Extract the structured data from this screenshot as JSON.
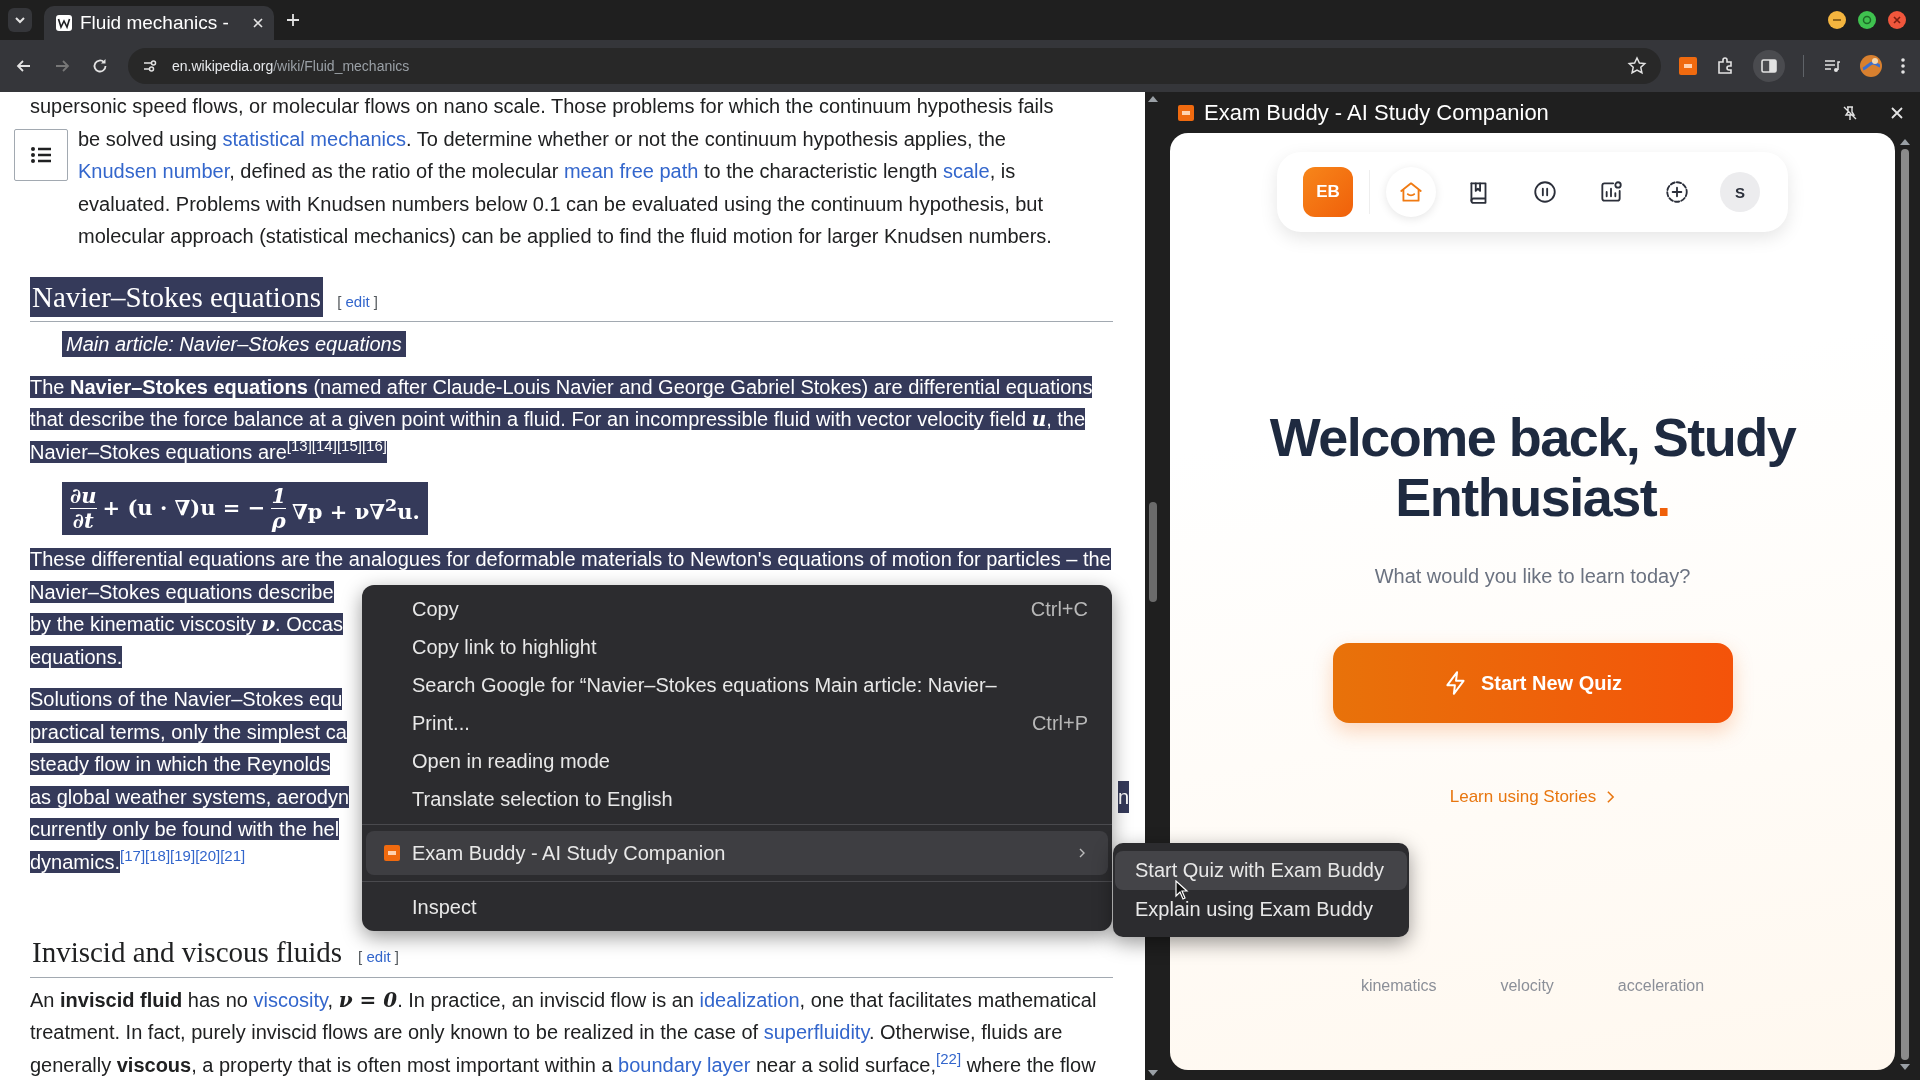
{
  "browser": {
    "tabs": [
      {
        "title": "Fluid mechanics -",
        "selected": true
      }
    ],
    "back_disabled": false,
    "forward_disabled": true,
    "url_host": "en.wikipedia.org",
    "url_path": "/wiki/Fluid_mechanics",
    "side_panel_open": true
  },
  "article": {
    "blocks": [
      {
        "kind": "paragraph",
        "highlighted": false,
        "parts": [
          {
            "kind": "text",
            "text": "supersonic speed flows, or molecular flows on nano scale. Those problems for which the continuum hypothesis fails"
          }
        ]
      },
      {
        "kind": "paragraph",
        "highlighted": false,
        "toc": true,
        "parts": [
          {
            "kind": "text",
            "text": "be solved using "
          },
          {
            "kind": "link",
            "text": "statistical mechanics"
          },
          {
            "kind": "text",
            "text": ". To determine whether or not the continuum hypothesis applies, the "
          },
          {
            "kind": "link",
            "text": "Knudsen number"
          },
          {
            "kind": "text",
            "text": ", defined as the ratio of the molecular "
          },
          {
            "kind": "link",
            "text": "mean free path"
          },
          {
            "kind": "text",
            "text": " to the characteristic length "
          },
          {
            "kind": "link",
            "text": "scale"
          },
          {
            "kind": "text",
            "text": ", is evaluated. Problems with Knudsen numbers below 0.1 can be evaluated using the continuum hypothesis, but molecular approach (statistical mechanics) can be applied to find the fluid motion for larger Knudsen numbers."
          }
        ]
      },
      {
        "kind": "heading",
        "highlighted": true,
        "text": "Navier–Stokes equations",
        "edit": "edit",
        "brackets": [
          "[",
          "]"
        ]
      },
      {
        "kind": "hatnote",
        "highlighted": true,
        "parts": [
          {
            "kind": "text",
            "text": "Main article: Navier–Stokes equations"
          }
        ]
      },
      {
        "kind": "paragraph",
        "highlighted": true,
        "parts": [
          {
            "kind": "text",
            "text": "The **Navier–Stokes equations** (named after Claude-Louis Navier and George Gabriel Stokes) are differential equations that describe the force balance at a given point within a fluid. For an incompressible fluid with vector velocity field "
          },
          {
            "kind": "math",
            "text": "u"
          },
          {
            "kind": "text",
            "text": ", the Navier–Stokes equations are"
          },
          {
            "kind": "ref",
            "text": "[13]"
          },
          {
            "kind": "ref",
            "text": "[14]"
          },
          {
            "kind": "ref",
            "text": "[15]"
          },
          {
            "kind": "ref",
            "text": "[16]"
          }
        ]
      },
      {
        "kind": "formula",
        "highlighted": true,
        "num1": "∂u",
        "den1": "∂t",
        "middle": "+ (u · ∇)u = −",
        "num2": "1",
        "den2": "ρ",
        "tail": "∇p + ν∇$^{2}$u."
      },
      {
        "kind": "lines",
        "highlighted": true,
        "lines": [
          {
            "parts": [
              {
                "kind": "text",
                "text": "These differential equations are the analogues for deformable materials to Newton's equations of motion for particles – the"
              }
            ]
          },
          {
            "parts": [
              {
                "kind": "text",
                "text": "Navier–Stokes equations describe"
              }
            ]
          },
          {
            "parts": [
              {
                "kind": "text",
                "text": "by the kinematic viscosity "
              },
              {
                "kind": "math",
                "text": "ν"
              },
              {
                "kind": "text",
                "text": ". Occas"
              }
            ]
          },
          {
            "parts": [
              {
                "kind": "text",
                "text": "equations."
              }
            ]
          }
        ]
      },
      {
        "kind": "lines",
        "highlighted": true,
        "lines": [
          {
            "parts": [
              {
                "kind": "text",
                "text": "Solutions of the Navier–Stokes equ"
              }
            ]
          },
          {
            "parts": [
              {
                "kind": "text",
                "text": "practical terms, only the simplest ca"
              }
            ]
          },
          {
            "parts": [
              {
                "kind": "text",
                "text": "steady flow in which the Reynolds"
              }
            ]
          },
          {
            "parts": [
              {
                "kind": "text",
                "text": "as global weather systems, aerodyn"
              }
            ],
            "tail": "n"
          },
          {
            "parts": [
              {
                "kind": "text",
                "text": "currently only be found with the hel"
              }
            ]
          },
          {
            "parts": [
              {
                "kind": "text",
                "text": "dynamics."
              },
              {
                "kind": "ref",
                "text": "[17]"
              },
              {
                "kind": "ref",
                "text": "[18]"
              },
              {
                "kind": "ref",
                "text": "[19]"
              },
              {
                "kind": "ref",
                "text": "[20]"
              },
              {
                "kind": "ref",
                "text": "[21]"
              }
            ]
          }
        ]
      },
      {
        "kind": "heading",
        "highlighted": false,
        "text": "Inviscid and viscous fluids",
        "edit": "edit",
        "brackets": [
          "[",
          "]"
        ]
      },
      {
        "kind": "paragraph",
        "highlighted": false,
        "parts": [
          {
            "kind": "text",
            "text": "An **inviscid fluid** has no "
          },
          {
            "kind": "link",
            "text": "viscosity"
          },
          {
            "kind": "text",
            "text": ", "
          },
          {
            "kind": "math",
            "text": "ν = 0"
          },
          {
            "kind": "text",
            "text": ". In practice, an inviscid flow is an "
          },
          {
            "kind": "link",
            "text": "idealization"
          },
          {
            "kind": "text",
            "text": ", one that facilitates mathematical treatment. In fact, purely inviscid flows are only known to be realized in the case of "
          },
          {
            "kind": "link",
            "text": "superfluidity"
          },
          {
            "kind": "text",
            "text": ". Otherwise, fluids are generally **viscous**, a property that is often most important within a "
          },
          {
            "kind": "link",
            "text": "boundary layer"
          },
          {
            "kind": "text",
            "text": " near a solid surface,"
          },
          {
            "kind": "ref",
            "text": "[22]"
          },
          {
            "kind": "text",
            "text": " where the flow"
          }
        ]
      }
    ]
  },
  "context_menu": {
    "items": [
      {
        "kind": "item",
        "label": "Copy",
        "shortcut": "Ctrl+C",
        "highlighted": false
      },
      {
        "kind": "item",
        "label": "Copy link to highlight",
        "highlighted": false
      },
      {
        "kind": "item",
        "label": "Search Google for “Navier–Stokes equations Main article: Navier–",
        "highlighted": false
      },
      {
        "kind": "item",
        "label": "Print...",
        "shortcut": "Ctrl+P",
        "highlighted": false
      },
      {
        "kind": "item",
        "label": "Open in reading mode",
        "highlighted": false
      },
      {
        "kind": "item",
        "label": "Translate selection to English",
        "highlighted": false
      },
      {
        "kind": "separator"
      },
      {
        "kind": "submenu",
        "label": "Exam Buddy - AI Study Companion",
        "highlighted": true
      },
      {
        "kind": "separator"
      },
      {
        "kind": "item",
        "label": "Inspect",
        "highlighted": false
      }
    ],
    "submenu": [
      {
        "label": "Start Quiz with Exam Buddy",
        "highlighted": true
      },
      {
        "label": "Explain using Exam Buddy",
        "highlighted": false
      }
    ]
  },
  "side_panel": {
    "title": "Exam Buddy - AI Study Companion",
    "logo": "EB",
    "nav": [
      {
        "kind": "home",
        "selected": true
      },
      {
        "kind": "library",
        "selected": false
      },
      {
        "kind": "pause",
        "selected": false
      },
      {
        "kind": "stats",
        "selected": false
      },
      {
        "kind": "add",
        "selected": false
      }
    ],
    "avatar": "S",
    "heading": "Welcome back, Study Enthusiast",
    "heading_mark": ".",
    "subtitle": "What would you like to learn today?",
    "primary_button": "Start New Quiz",
    "link": "Learn using Stories",
    "topics": [
      "kinematics",
      "velocity",
      "acceleration"
    ]
  }
}
